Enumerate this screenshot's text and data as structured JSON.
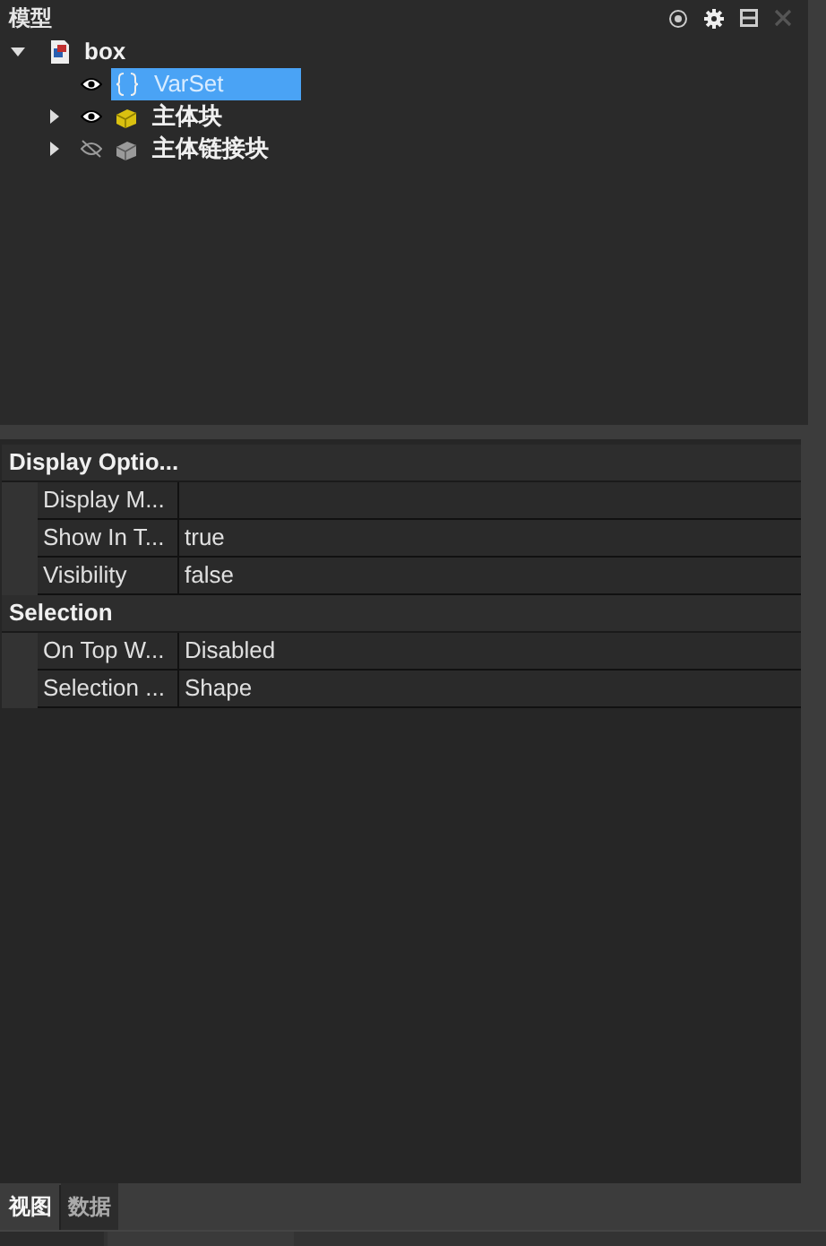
{
  "panel": {
    "title": "模型"
  },
  "tree": [
    {
      "label": "box",
      "kind": "document",
      "expanded": true,
      "selected": false,
      "children": [
        {
          "label": "VarSet",
          "kind": "varset",
          "selected": true,
          "visible": true
        },
        {
          "label": "主体块",
          "kind": "body",
          "selected": false,
          "visible": true,
          "expanded": false
        },
        {
          "label": "主体链接块",
          "kind": "link",
          "selected": false,
          "visible": false,
          "expanded": false
        }
      ]
    }
  ],
  "properties": [
    {
      "group": "Display Optio...",
      "rows": [
        {
          "name": "Display M..."
        },
        {
          "name": "Show In T...",
          "value": "true"
        },
        {
          "name": "Visibility",
          "value": "false"
        }
      ]
    },
    {
      "group": "Selection",
      "rows": [
        {
          "name": "On Top W...",
          "value": "Disabled"
        },
        {
          "name": "Selection ...",
          "value": "Shape"
        }
      ]
    }
  ],
  "tabs": [
    {
      "label": "视图",
      "selected": true
    },
    {
      "label": "数据",
      "selected": false
    }
  ]
}
